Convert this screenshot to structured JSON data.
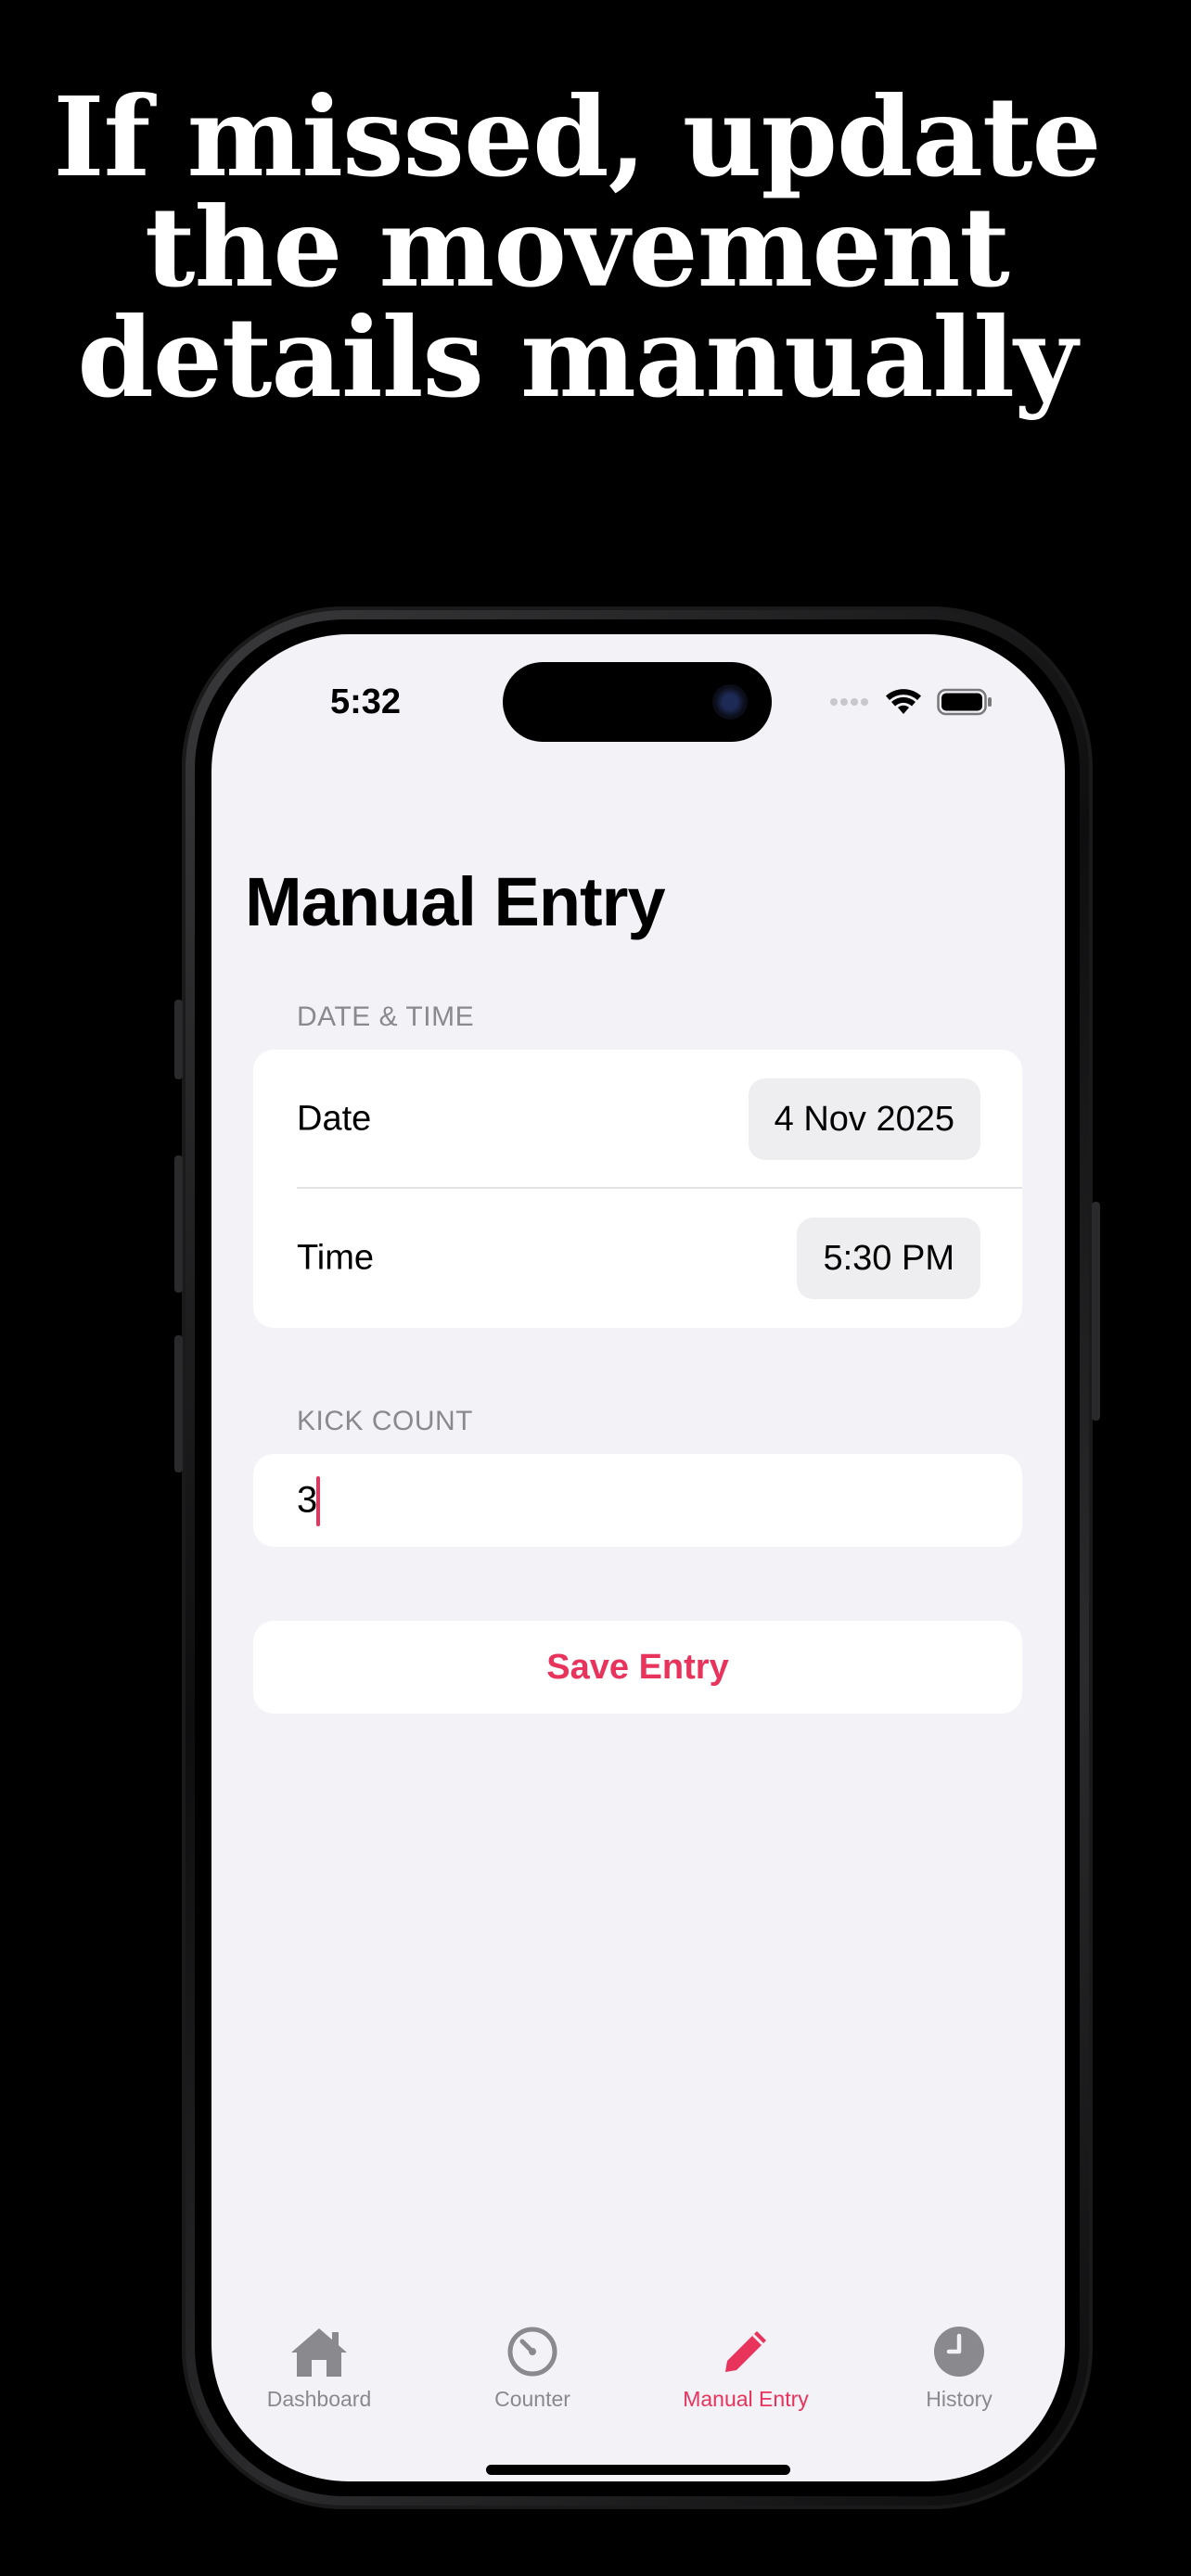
{
  "headline": {
    "line1": "If missed, update",
    "line2": "the movement",
    "line3": "details manually"
  },
  "status_bar": {
    "time": "5:32"
  },
  "page": {
    "title": "Manual Entry"
  },
  "date_time_section": {
    "header": "DATE & TIME",
    "date_label": "Date",
    "date_value": "4 Nov 2025",
    "time_label": "Time",
    "time_value": "5:30 PM"
  },
  "kick_count_section": {
    "header": "KICK COUNT",
    "value": "3"
  },
  "save_button": {
    "label": "Save Entry"
  },
  "tab_bar": {
    "items": [
      {
        "label": "Dashboard",
        "icon": "house-icon",
        "active": false
      },
      {
        "label": "Counter",
        "icon": "gauge-icon",
        "active": false
      },
      {
        "label": "Manual Entry",
        "icon": "pencil-icon",
        "active": true
      },
      {
        "label": "History",
        "icon": "clock-icon",
        "active": false
      }
    ]
  },
  "colors": {
    "accent": "#e8335c",
    "background": "#f2f2f7",
    "inactive": "#8a8a8e"
  }
}
